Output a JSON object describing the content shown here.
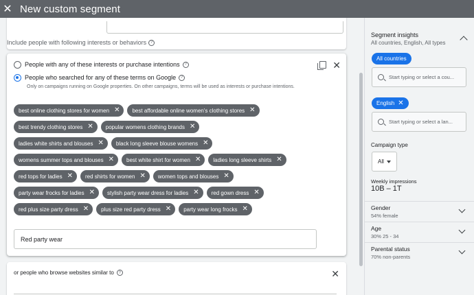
{
  "header": {
    "title": "New custom segment"
  },
  "main": {
    "include_label": "Include people with following interests or behaviors",
    "option_interests": "People with any of these interests or purchase intentions",
    "option_search": "People who searched for any of these terms on Google",
    "option_search_sub": "Only on campaigns running on Google properties. On other campaigns, terms will be used as interests or purchase intentions.",
    "chip_rows": [
      [
        "best online clothing stores for women",
        "best affordable online women's clothing stores"
      ],
      [
        "best trendy clothing stores",
        "popular womens clothing brands"
      ],
      [
        "ladies white shirts and blouses",
        "black long sleeve blouse womens"
      ],
      [
        "womens summer tops and blouses",
        "best white shirt for women",
        "ladies long sleeve shirts"
      ],
      [
        "red tops for ladies",
        "red shirts for women",
        "women tops and blouses"
      ],
      [
        "party wear frocks for ladies",
        "stylish party wear dress for ladies",
        "red gown dress"
      ],
      [
        "red plus size party dress",
        "plus size red party dress",
        "party wear long frocks"
      ]
    ],
    "input_value": "Red party wear",
    "websites_label": "or people who browse websites similar to"
  },
  "side": {
    "title": "Segment insights",
    "subtitle": "All countries, English, All types",
    "location_chip": "All countries",
    "location_placeholder": "Start typing or select a cou...",
    "language_chip": "English",
    "language_placeholder": "Start typing or select a lan...",
    "campaign_type_label": "Campaign type",
    "campaign_type_value": "All",
    "weekly_label": "Weekly impressions",
    "weekly_value": "10B – 1T",
    "gender_label": "Gender",
    "gender_value": "54% female",
    "age_label": "Age",
    "age_value": "30% 25 - 34",
    "parental_label": "Parental status",
    "parental_value": "70% non-parents"
  },
  "colors": {
    "accent": "#1a73e8",
    "chip": "#5f6368",
    "header": "#5f6368"
  }
}
